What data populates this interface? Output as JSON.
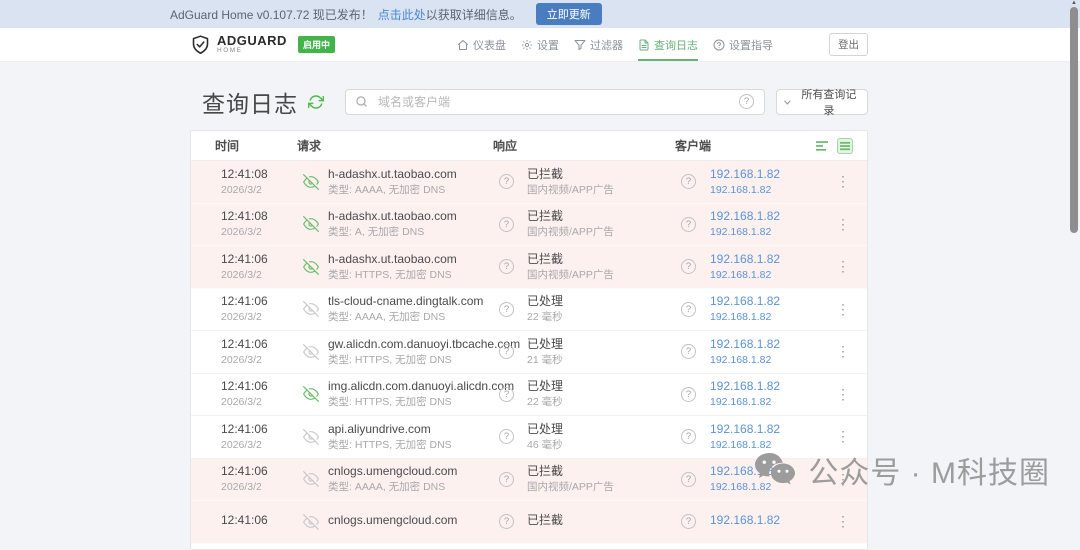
{
  "banner": {
    "message": "AdGuard Home v0.107.72 现已发布！",
    "link_label": "点击此处",
    "message_suffix": "以获取详细信息。",
    "update_button_label": "立即更新"
  },
  "nav": {
    "brand": "ADGUARD",
    "brand_sub": "HOME",
    "status_badge": "启用中",
    "items": [
      {
        "icon": "dashboard",
        "label": "仪表盘",
        "active": false
      },
      {
        "icon": "settings",
        "label": "设置",
        "active": false
      },
      {
        "icon": "filters",
        "label": "过滤器",
        "active": false
      },
      {
        "icon": "query-log",
        "label": "查询日志",
        "active": true
      },
      {
        "icon": "guide",
        "label": "设置指导",
        "active": false
      }
    ],
    "logout_label": "登出"
  },
  "toolbar": {
    "title": "查询日志",
    "search_placeholder": "域名或客户端",
    "filter_label": "所有查询记录"
  },
  "table": {
    "headers": {
      "time": "时间",
      "request": "请求",
      "response": "响应",
      "client": "客户端"
    },
    "rows": [
      {
        "time": "12:41:08",
        "date": "2026/3/2",
        "domain": "h-adashx.ut.taobao.com",
        "type": "类型: AAAA, 无加密 DNS",
        "status": "已拦截",
        "status_detail": "国内视频/APP广告",
        "client_ip": "192.168.1.82",
        "client_name": "192.168.1.82",
        "blocked": true,
        "eye": "green"
      },
      {
        "time": "12:41:08",
        "date": "2026/3/2",
        "domain": "h-adashx.ut.taobao.com",
        "type": "类型: A, 无加密 DNS",
        "status": "已拦截",
        "status_detail": "国内视频/APP广告",
        "client_ip": "192.168.1.82",
        "client_name": "192.168.1.82",
        "blocked": true,
        "eye": "green"
      },
      {
        "time": "12:41:06",
        "date": "2026/3/2",
        "domain": "h-adashx.ut.taobao.com",
        "type": "类型: HTTPS, 无加密 DNS",
        "status": "已拦截",
        "status_detail": "国内视频/APP广告",
        "client_ip": "192.168.1.82",
        "client_name": "192.168.1.82",
        "blocked": true,
        "eye": "green"
      },
      {
        "time": "12:41:06",
        "date": "2026/3/2",
        "domain": "tls-cloud-cname.dingtalk.com",
        "type": "类型: AAAA, 无加密 DNS",
        "status": "已处理",
        "status_detail": "22 毫秒",
        "client_ip": "192.168.1.82",
        "client_name": "192.168.1.82",
        "blocked": false,
        "eye": "gray"
      },
      {
        "time": "12:41:06",
        "date": "2026/3/2",
        "domain": "gw.alicdn.com.danuoyi.tbcache.com",
        "type": "类型: HTTPS, 无加密 DNS",
        "status": "已处理",
        "status_detail": "21 毫秒",
        "client_ip": "192.168.1.82",
        "client_name": "192.168.1.82",
        "blocked": false,
        "eye": "gray"
      },
      {
        "time": "12:41:06",
        "date": "2026/3/2",
        "domain": "img.alicdn.com.danuoyi.alicdn.com",
        "type": "类型: HTTPS, 无加密 DNS",
        "status": "已处理",
        "status_detail": "22 毫秒",
        "client_ip": "192.168.1.82",
        "client_name": "192.168.1.82",
        "blocked": false,
        "eye": "green"
      },
      {
        "time": "12:41:06",
        "date": "2026/3/2",
        "domain": "api.aliyundrive.com",
        "type": "类型: HTTPS, 无加密 DNS",
        "status": "已处理",
        "status_detail": "46 毫秒",
        "client_ip": "192.168.1.82",
        "client_name": "192.168.1.82",
        "blocked": false,
        "eye": "gray"
      },
      {
        "time": "12:41:06",
        "date": "2026/3/2",
        "domain": "cnlogs.umengcloud.com",
        "type": "类型: AAAA, 无加密 DNS",
        "status": "已拦截",
        "status_detail": "国内视频/APP广告",
        "client_ip": "192.168.1.82",
        "client_name": "192.168.1.82",
        "blocked": true,
        "eye": "gray"
      },
      {
        "time": "12:41:06",
        "date": "",
        "domain": "cnlogs.umengcloud.com",
        "type": "",
        "status": "已拦截",
        "status_detail": "",
        "client_ip": "192.168.1.82",
        "client_name": "",
        "blocked": true,
        "eye": "gray"
      }
    ]
  },
  "watermark": "公众号 · M科技圈",
  "colors": {
    "accent_green": "#67b279",
    "badge_green": "#43b34b",
    "banner_bg": "#d9e3f2",
    "update_button_bg": "#4a7dc0",
    "link_blue": "#4a88cf",
    "ip_link_blue": "#5b93d6",
    "blocked_row_bg": "#fdf1f0",
    "page_bg": "#f2f4f7"
  }
}
